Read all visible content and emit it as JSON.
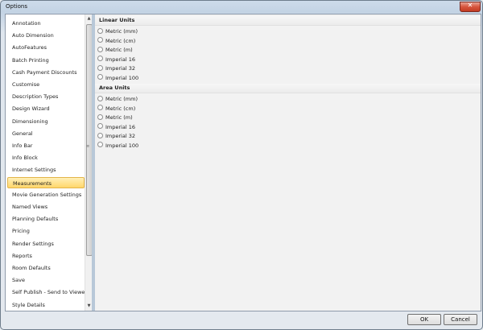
{
  "window": {
    "title": "Options",
    "close_glyph": "✕"
  },
  "sidebar": {
    "items": [
      {
        "label": "Annotation",
        "selected": false
      },
      {
        "label": "Auto Dimension",
        "selected": false
      },
      {
        "label": "AutoFeatures",
        "selected": false
      },
      {
        "label": "Batch Printing",
        "selected": false
      },
      {
        "label": "Cash Payment Discounts",
        "selected": false
      },
      {
        "label": "Customise",
        "selected": false
      },
      {
        "label": "Description Types",
        "selected": false
      },
      {
        "label": "Design Wizard",
        "selected": false
      },
      {
        "label": "Dimensioning",
        "selected": false
      },
      {
        "label": "General",
        "selected": false
      },
      {
        "label": "Info Bar",
        "selected": false
      },
      {
        "label": "Info Block",
        "selected": false
      },
      {
        "label": "Internet Settings",
        "selected": false
      },
      {
        "label": "Measurements",
        "selected": true
      },
      {
        "label": "Movie Generation Settings",
        "selected": false
      },
      {
        "label": "Named Views",
        "selected": false
      },
      {
        "label": "Planning Defaults",
        "selected": false
      },
      {
        "label": "Pricing",
        "selected": false
      },
      {
        "label": "Render Settings",
        "selected": false
      },
      {
        "label": "Reports",
        "selected": false
      },
      {
        "label": "Room Defaults",
        "selected": false
      },
      {
        "label": "Save",
        "selected": false
      },
      {
        "label": "Self Publish - Send to Viewer",
        "selected": false
      },
      {
        "label": "Style Details",
        "selected": false
      }
    ],
    "scroll_up_glyph": "▲",
    "scroll_down_glyph": "▼"
  },
  "linear_units": {
    "header": "Linear Units",
    "options": [
      "Metric (mm)",
      "Metric (cm)",
      "Metric (m)",
      "Imperial 16",
      "Imperial 32",
      "Imperial 100"
    ]
  },
  "area_units": {
    "header": "Area Units",
    "options": [
      "Metric (mm)",
      "Metric (cm)",
      "Metric (m)",
      "Imperial 16",
      "Imperial 32",
      "Imperial 100"
    ]
  },
  "footer": {
    "ok_label": "OK",
    "cancel_label": "Cancel"
  }
}
